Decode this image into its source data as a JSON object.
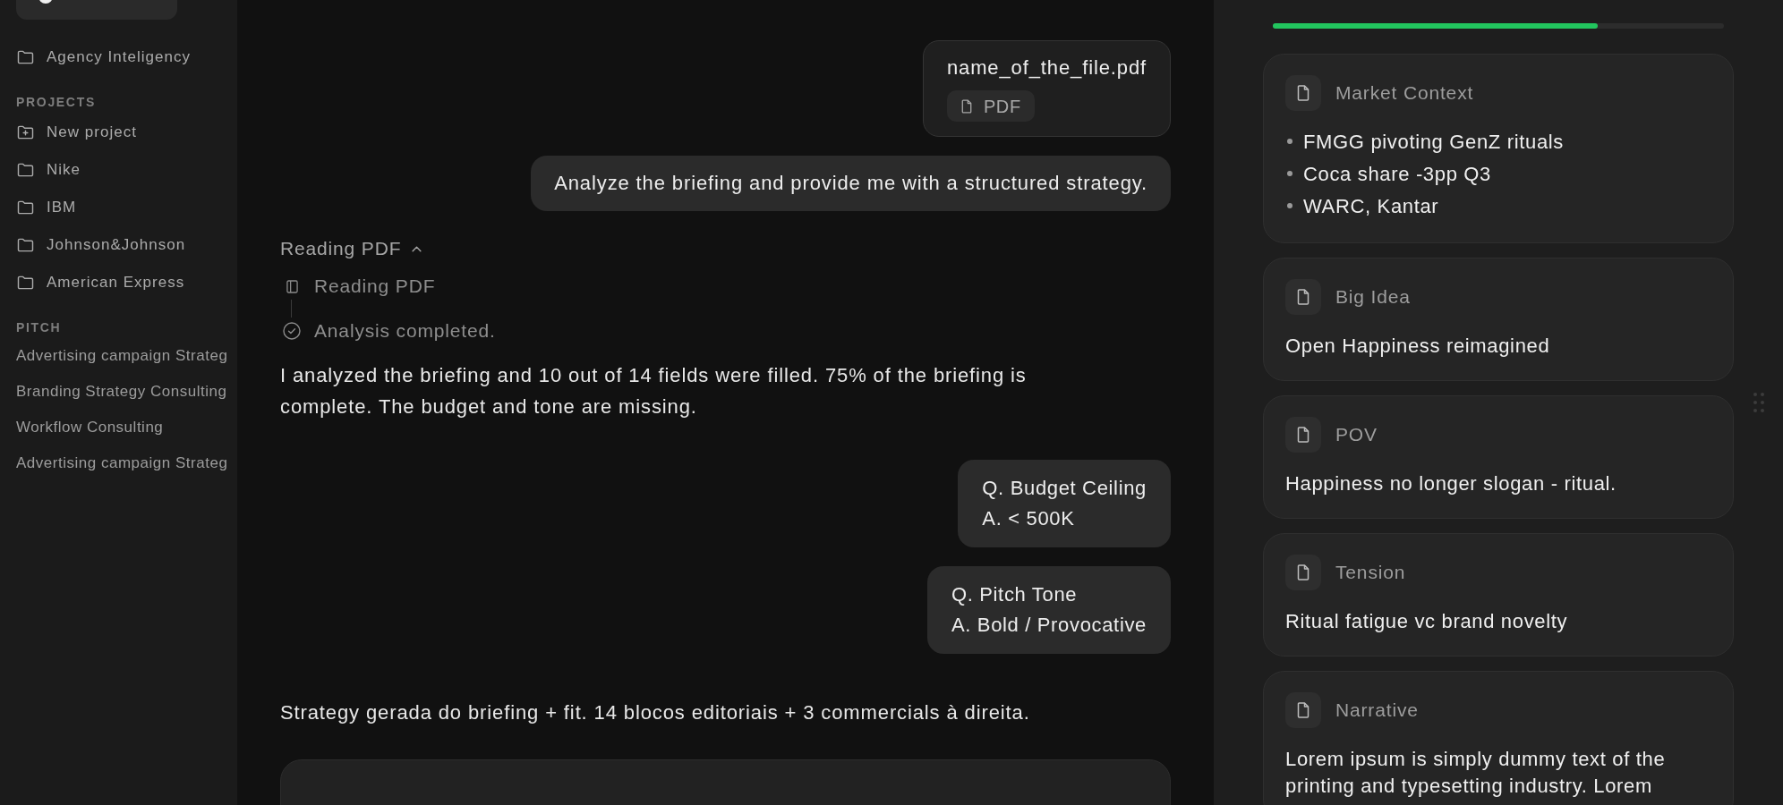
{
  "sidebar": {
    "items": [
      {
        "label": "Agency Inteligency",
        "kind": "folder"
      }
    ],
    "sections": [
      {
        "title": "PROJECTS",
        "items": [
          {
            "label": "New project",
            "kind": "new"
          },
          {
            "label": "Nike",
            "kind": "folder"
          },
          {
            "label": "IBM",
            "kind": "folder"
          },
          {
            "label": "Johnson&Johnson",
            "kind": "folder"
          },
          {
            "label": "American Express",
            "kind": "folder"
          }
        ]
      },
      {
        "title": "PITCH",
        "items": [
          {
            "label": "Advertising campaign Strateg",
            "kind": "text"
          },
          {
            "label": "Branding Strategy Consulting",
            "kind": "text"
          },
          {
            "label": "Workflow Consulting",
            "kind": "text"
          },
          {
            "label": "Advertising campaign Strateg",
            "kind": "text"
          }
        ]
      }
    ]
  },
  "chat": {
    "messages": [
      {
        "kind": "file",
        "name": "name_of_the_file.pdf",
        "type": "PDF"
      },
      {
        "kind": "user",
        "text": "Analyze the briefing and provide me with a structured strategy."
      },
      {
        "kind": "steps",
        "title": "Reading PDF",
        "expanded": true,
        "steps": [
          {
            "kind": "reading",
            "label": "Reading PDF"
          },
          {
            "kind": "done",
            "label": "Analysis completed."
          }
        ]
      },
      {
        "kind": "assistant",
        "text": "I analyzed the briefing and 10 out of 14 fields were filled. 75% of the briefing is complete. The budget and tone are missing."
      },
      {
        "kind": "qa",
        "question": "Q. Budget Ceiling",
        "answer": "A. < 500K"
      },
      {
        "kind": "qa",
        "question": "Q. Pitch Tone",
        "answer": "A. Bold / Provocative"
      },
      {
        "kind": "assistant",
        "text": "Strategy gerada do briefing + fit. 14 blocos editoriais + 3 commercials à direita."
      },
      {
        "kind": "card"
      }
    ]
  },
  "panel": {
    "progress": {
      "level": 0.72
    },
    "cards": [
      {
        "kind": "list",
        "title": "Market Context",
        "bullets": [
          "FMGG pivoting GenZ rituals",
          "Coca share -3pp Q3",
          "WARC, Kantar"
        ]
      },
      {
        "kind": "text",
        "title": "Big Idea",
        "text": "Open Happiness reimagined"
      },
      {
        "kind": "text",
        "title": "POV",
        "text": "Happiness no longer slogan - ritual."
      },
      {
        "kind": "text",
        "title": "Tension",
        "text": "Ritual fatigue vc brand novelty"
      },
      {
        "kind": "text",
        "title": "Narrative",
        "text": "Lorem ipsum is simply dummy text of the printing and typesetting industry. Lorem"
      }
    ]
  }
}
